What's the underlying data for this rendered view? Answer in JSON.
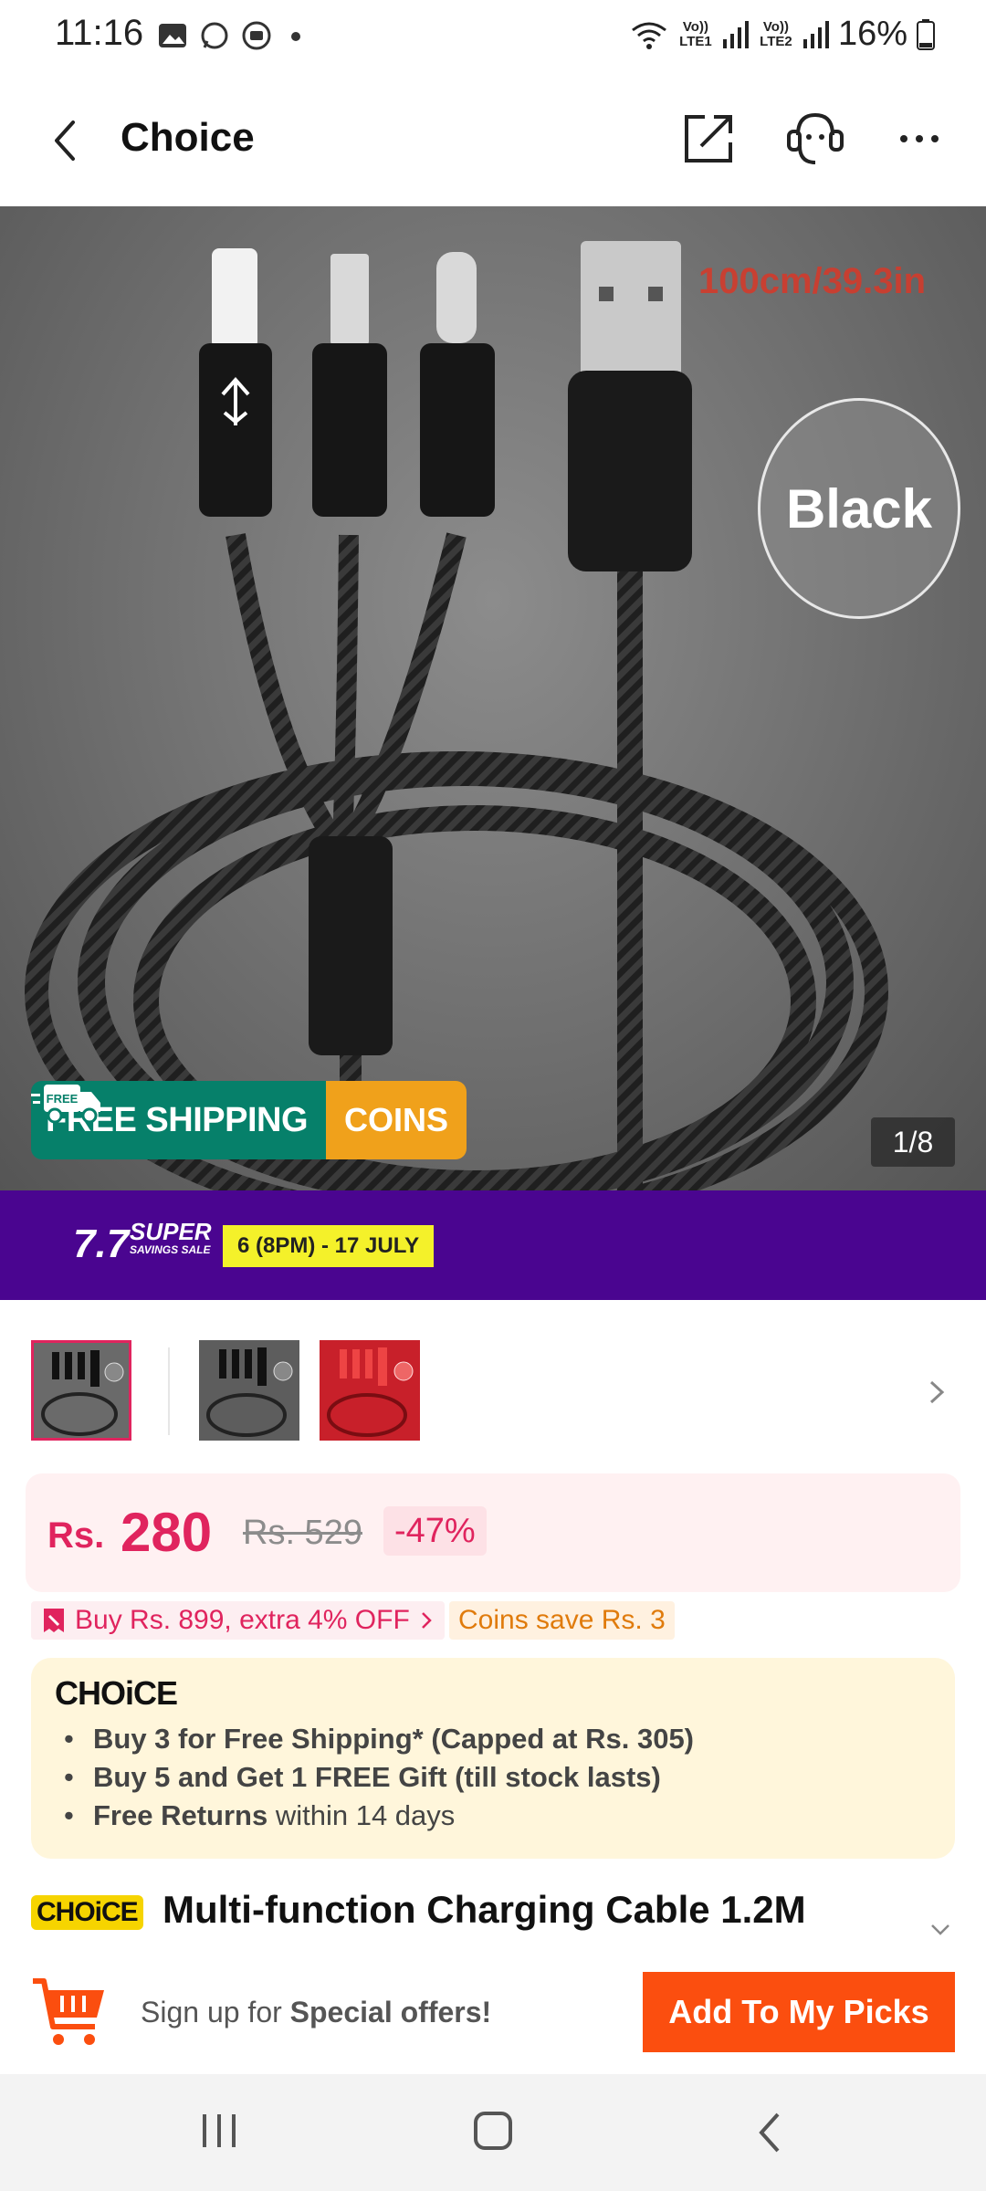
{
  "status_bar": {
    "time": "11:16",
    "sim1": "Vo)) LTE1",
    "sim2": "Vo)) LTE2",
    "battery": "16%"
  },
  "header": {
    "title": "Choice",
    "icons": [
      "back-arrow-icon",
      "share-icon",
      "customer-support-icon",
      "more-icon"
    ]
  },
  "gallery": {
    "length_label": "100cm/39.3in",
    "color_label": "Black",
    "shipping_badge": {
      "free_tag": "FREE",
      "text": "FREE SHIPPING",
      "coins": "COINS"
    },
    "counter": "1/8"
  },
  "promo_banner": {
    "big": "7.7",
    "super": "SUPER",
    "small": "SAVINGS SALE",
    "date": "6 (8PM) - 17 JULY"
  },
  "thumbnails": [
    {
      "name": "black-cable",
      "label": "Black"
    },
    {
      "name": "grey-cable",
      "label": "Black"
    },
    {
      "name": "red-cable",
      "label": "Red"
    }
  ],
  "price": {
    "currency": "Rs.",
    "value": "280",
    "original": "Rs. 529",
    "discount": "-47%"
  },
  "offers": {
    "bundle": "Buy Rs. 899, extra 4% OFF",
    "coins": "Coins save Rs. 3"
  },
  "choice": {
    "logo": "CHOiCE",
    "items": [
      {
        "bold": "Buy 3 for  Free Shipping* (Capped at Rs. 305)",
        "rest": ""
      },
      {
        "bold": "Buy 5 and Get 1 FREE Gift (till stock lasts)",
        "rest": ""
      },
      {
        "bold": "Free Returns",
        "rest": " within 14 days"
      }
    ]
  },
  "product": {
    "badge": "CHOiCE",
    "title": "Multi-function Charging Cable 1.2M"
  },
  "action_bar": {
    "signup_prefix": "Sign up for ",
    "signup_bold": "Special offers!",
    "button": "Add To My Picks"
  },
  "colors": {
    "accent": "#fb4e0f",
    "price": "#e0245e",
    "promo": "#4a0590",
    "shipping": "#06806a",
    "coins": "#f0a11b"
  }
}
